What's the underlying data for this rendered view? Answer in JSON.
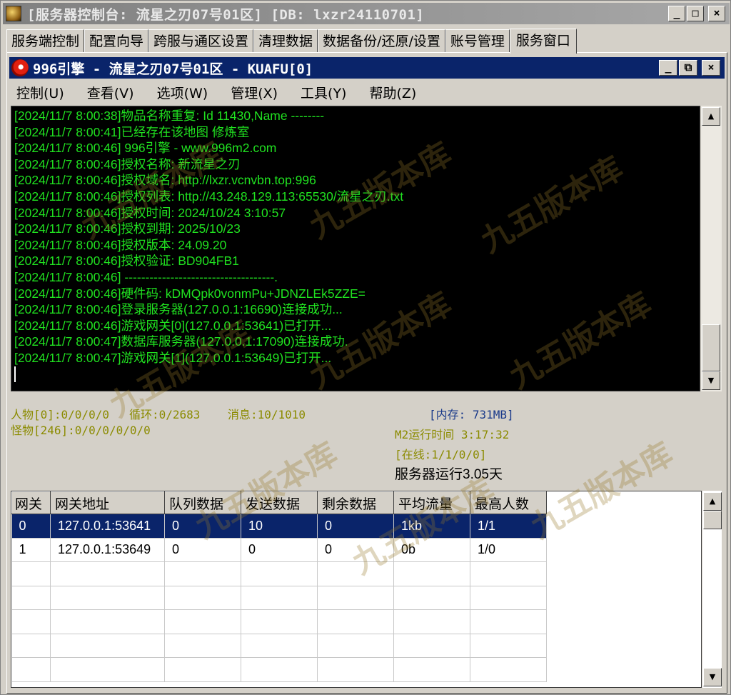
{
  "window": {
    "title": "[服务器控制台: 流星之刃07号01区] [DB: lxzr24110701]",
    "min_glyph": "_",
    "max_glyph": "□",
    "close_glyph": "×"
  },
  "tabs": [
    {
      "label": "服务端控制"
    },
    {
      "label": "配置向导"
    },
    {
      "label": "跨服与通区设置"
    },
    {
      "label": "清理数据"
    },
    {
      "label": "数据备份/还原/设置"
    },
    {
      "label": "账号管理"
    },
    {
      "label": "服务窗口",
      "active": true
    }
  ],
  "inner_window": {
    "title": "996引擎 - 流星之刃07号01区 - KUAFU[0]",
    "min_glyph": "_",
    "restore_glyph": "⧉",
    "close_glyph": "×"
  },
  "menu": [
    {
      "label": "控制(U)"
    },
    {
      "label": "查看(V)"
    },
    {
      "label": "选项(W)"
    },
    {
      "label": "管理(X)"
    },
    {
      "label": "工具(Y)"
    },
    {
      "label": "帮助(Z)"
    }
  ],
  "log": [
    "[2024/11/7 8:00:38]物品名称重复: Id 11430,Name --------",
    "[2024/11/7 8:00:41]已经存在该地图 修炼室",
    "[2024/11/7 8:00:46] 996引擎 - www.996m2.com",
    "[2024/11/7 8:00:46]授权名称: 新流星之刃",
    "[2024/11/7 8:00:46]授权域名: http://lxzr.vcnvbn.top:996",
    "[2024/11/7 8:00:46]授权列表: http://43.248.129.113:65530/流星之刃.txt",
    "[2024/11/7 8:00:46]授权时间: 2024/10/24 3:10:57",
    "[2024/11/7 8:00:46]授权到期: 2025/10/23",
    "[2024/11/7 8:00:46]授权版本: 24.09.20",
    "[2024/11/7 8:00:46]授权验证: BD904FB1",
    "[2024/11/7 8:00:46] ------------------------------------.",
    "[2024/11/7 8:00:46]硬件码: kDMQpk0vonmPu+JDNZLEk5ZZE=",
    "[2024/11/7 8:00:46]登录服务器(127.0.0.1:16690)连接成功...",
    "[2024/11/7 8:00:46]游戏网关[0](127.0.0.1:53641)已打开...",
    "[2024/11/7 8:00:47]数据库服务器(127.0.0.1:17090)连接成功.",
    "[2024/11/7 8:00:47]游戏网关[1](127.0.0.1:53649)已打开..."
  ],
  "status": {
    "players": "人物[0]:0/0/0/0",
    "loop": "循环:0/2683",
    "messages": "消息:10/1010",
    "monsters": "怪物[246]:0/0/0/0/0/0",
    "memory": "[内存: 731MB]",
    "m2_runtime": "M2运行时间 3:17:32",
    "online": "[在线:1/1/0/0]",
    "server_uptime": "服务器运行3.05天"
  },
  "gateway_table": {
    "columns": [
      "网关",
      "网关地址",
      "队列数据",
      "发送数据",
      "剩余数据",
      "平均流量",
      "最高人数"
    ],
    "rows": [
      [
        "0",
        "127.0.0.1:53641",
        "0",
        "10",
        "0",
        "1kb",
        "1/1"
      ],
      [
        "1",
        "127.0.0.1:53649",
        "0",
        "0",
        "0",
        "0b",
        "1/0"
      ],
      [
        "",
        "",
        "",
        "",
        "",
        "",
        ""
      ],
      [
        "",
        "",
        "",
        "",
        "",
        "",
        ""
      ],
      [
        "",
        "",
        "",
        "",
        "",
        "",
        ""
      ],
      [
        "",
        "",
        "",
        "",
        "",
        "",
        ""
      ],
      [
        "",
        "",
        "",
        "",
        "",
        "",
        ""
      ]
    ]
  },
  "watermark": "九五版本库",
  "colors": {
    "log_text": "#20e020",
    "selection": "#0a246a",
    "status_olive": "#8b8b00",
    "status_blue": "#1a3a8a"
  }
}
